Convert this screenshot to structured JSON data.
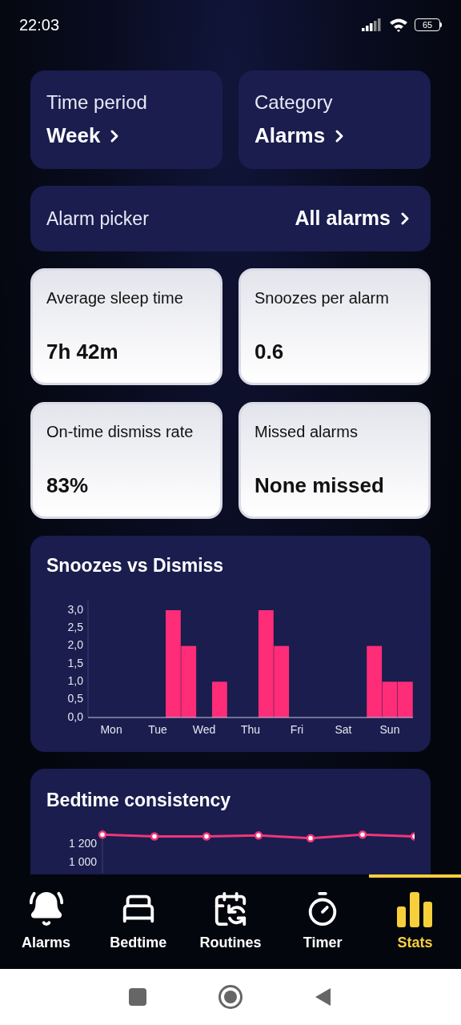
{
  "status_bar": {
    "time": "22:03",
    "battery": "65"
  },
  "filters": [
    {
      "label": "Time period",
      "value": "Week"
    },
    {
      "label": "Category",
      "value": "Alarms"
    }
  ],
  "alarm_picker": {
    "label": "Alarm picker",
    "value": "All alarms"
  },
  "stats": [
    {
      "label": "Average sleep time",
      "value": "7h 42m"
    },
    {
      "label": "Snoozes per alarm",
      "value": "0.6"
    },
    {
      "label": "On-time dismiss rate",
      "value": "83%"
    },
    {
      "label": "Missed alarms",
      "value": "None missed"
    }
  ],
  "snooze_chart": {
    "title": "Snoozes vs Dismiss",
    "chart_data": {
      "type": "bar",
      "categories": [
        "Mon",
        null,
        null,
        "Tue",
        null,
        null,
        "Wed",
        null,
        null,
        "Thu",
        null,
        null,
        "Fri",
        null,
        null,
        "Sat",
        null,
        null,
        "Sun",
        null
      ],
      "series": [
        {
          "color": "#ff2d78",
          "values": [
            0,
            0,
            0,
            0,
            3,
            2,
            0,
            1,
            0,
            0,
            3,
            2,
            0,
            0,
            0,
            0,
            0,
            2,
            1,
            1
          ]
        }
      ],
      "ylim": [
        0,
        3
      ],
      "yticks": [
        {
          "value": 0,
          "label": "0,0"
        },
        {
          "value": 0.5,
          "label": "0,5"
        },
        {
          "value": 1,
          "label": "1,0"
        },
        {
          "value": 1.5,
          "label": "1,5"
        },
        {
          "value": 2,
          "label": "2,0"
        },
        {
          "value": 2.5,
          "label": "2,5"
        },
        {
          "value": 3,
          "label": "3,0"
        }
      ]
    }
  },
  "bedtime_chart": {
    "title": "Bedtime consistency",
    "chart_data": {
      "type": "line",
      "series": [
        {
          "color": "#f0357a",
          "marker": "circle",
          "values": [
            1320,
            1300,
            1300,
            1310,
            1280,
            1320,
            1300
          ]
        }
      ],
      "ylim": [
        900,
        1400
      ],
      "yticks": [
        {
          "value": 1000,
          "label": "1 000"
        },
        {
          "value": 1200,
          "label": "1 200"
        }
      ]
    }
  },
  "nav": [
    {
      "label": "Alarms",
      "selected": false
    },
    {
      "label": "Bedtime",
      "selected": false
    },
    {
      "label": "Routines",
      "selected": false
    },
    {
      "label": "Timer",
      "selected": false
    },
    {
      "label": "Stats",
      "selected": true
    }
  ]
}
